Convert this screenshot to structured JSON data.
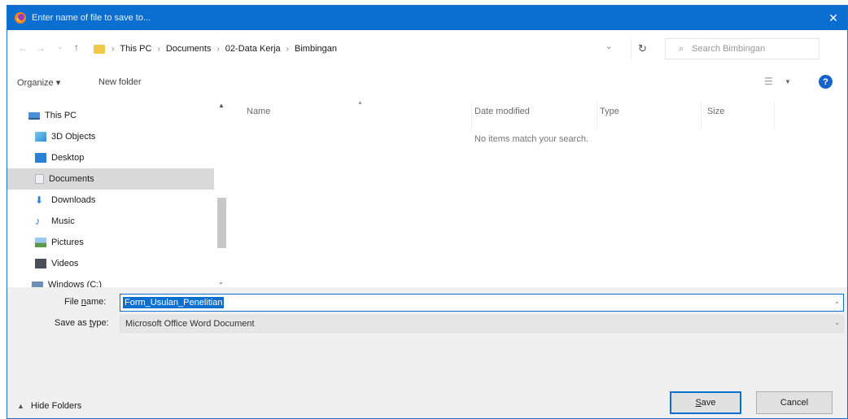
{
  "window": {
    "title": "Enter name of file to save to..."
  },
  "address_bar": {
    "breadcrumbs": [
      "This PC",
      "Documents",
      "02-Data Kerja",
      "Bimbingan"
    ],
    "search_placeholder": "Search Bimbingan"
  },
  "toolbar": {
    "organize_label": "Organize ▾",
    "new_folder_label": "New folder"
  },
  "nav_pane": {
    "items": [
      {
        "label": "This PC",
        "icon": "pc-icon"
      },
      {
        "label": "3D Objects",
        "icon": "cube-icon"
      },
      {
        "label": "Desktop",
        "icon": "desktop-icon"
      },
      {
        "label": "Documents",
        "icon": "documents-icon",
        "selected": true
      },
      {
        "label": "Downloads",
        "icon": "download-icon"
      },
      {
        "label": "Music",
        "icon": "music-icon"
      },
      {
        "label": "Pictures",
        "icon": "pictures-icon"
      },
      {
        "label": "Videos",
        "icon": "videos-icon"
      },
      {
        "label": "Windows (C:)",
        "icon": "drive-icon"
      }
    ]
  },
  "file_list": {
    "columns": [
      "Name",
      "Date modified",
      "Type",
      "Size"
    ],
    "empty_message": "No items match your search."
  },
  "form": {
    "file_name_label_pre": "File ",
    "file_name_label_u": "n",
    "file_name_label_post": "ame:",
    "file_name_value": "Form_Usulan_Penelitian",
    "save_type_label_pre": "Save as ",
    "save_type_label_u": "t",
    "save_type_label_post": "ype:",
    "save_type_value": "Microsoft Office Word Document"
  },
  "footer": {
    "hide_folders_label": "Hide Folders",
    "save_label_u": "S",
    "save_label_rest": "ave",
    "cancel_label": "Cancel"
  },
  "colors": {
    "accent": "#0a6fd1",
    "selection": "#d9d9d9",
    "folder": "#f3c84a"
  }
}
